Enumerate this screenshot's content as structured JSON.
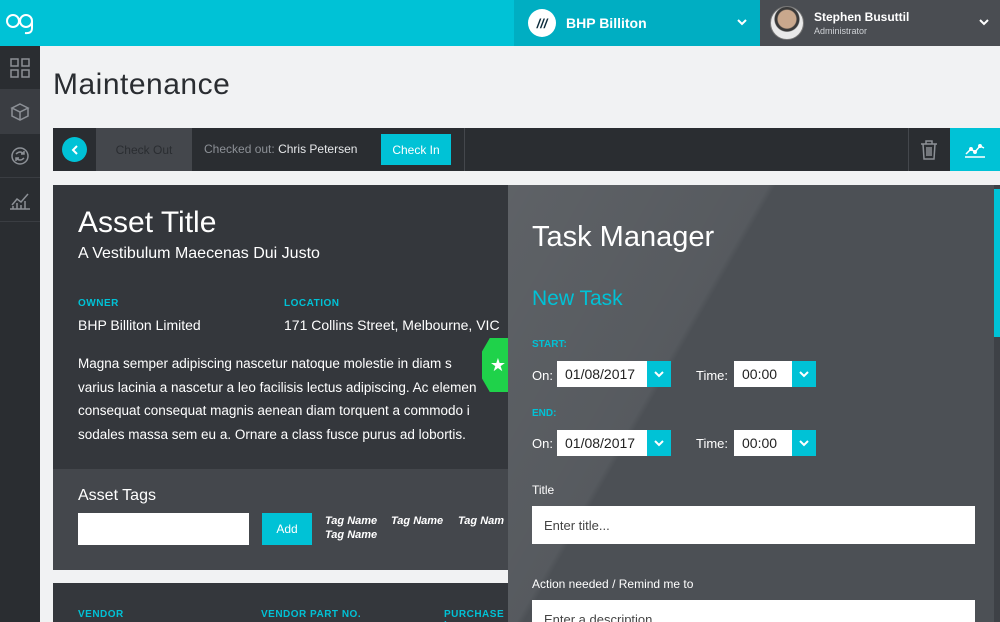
{
  "header": {
    "company": {
      "name": "BHP Billiton",
      "logo_text": "///"
    },
    "user": {
      "name": "Stephen Busuttil",
      "role": "Administrator"
    }
  },
  "sidebar": {
    "items": [
      {
        "icon": "dashboard-grid-icon"
      },
      {
        "icon": "cube-icon",
        "active": true
      },
      {
        "icon": "refresh-cycle-icon"
      },
      {
        "icon": "analytics-chart-icon"
      }
    ]
  },
  "page": {
    "title": "Maintenance"
  },
  "toolbar": {
    "checkout_label": "Check Out",
    "checked_out_prefix": "Checked out:",
    "checked_out_person": "Chris Petersen",
    "checkin_label": "Check In"
  },
  "asset": {
    "title": "Asset Title",
    "subtitle": "A Vestibulum Maecenas Dui Justo",
    "owner_label": "OWNER",
    "owner_value": "BHP Billiton Limited",
    "location_label": "LOCATION",
    "location_value": "171 Collins Street, Melbourne, VIC",
    "description_lines": [
      "Magna semper adipiscing nascetur natoque molestie in diam s",
      "varius lacinia a nascetur a leo facilisis lectus adipiscing. Ac elemen",
      "consequat consequat magnis aenean diam torquent a commodo i",
      "sodales massa sem eu a. Ornare a class fusce purus ad lobortis."
    ]
  },
  "tags": {
    "title": "Asset Tags",
    "add_label": "Add",
    "items": [
      "Tag Name",
      "Tag Name",
      "Tag Nam",
      "Tag Name"
    ]
  },
  "vendor": {
    "vendor_label": "VENDOR",
    "part_label": "VENDOR PART NO.",
    "purchase_label": "PURCHASE I"
  },
  "task_manager": {
    "title": "Task Manager",
    "new_task": "New Task",
    "start_label": "START:",
    "end_label": "END:",
    "on_label": "On:",
    "time_label": "Time:",
    "start_date": "01/08/2017",
    "start_time": "00:00",
    "end_date": "01/08/2017",
    "end_time": "00:00",
    "title_field_label": "Title",
    "title_placeholder": "Enter title...",
    "action_label": "Action needed / Remind me to",
    "description_placeholder": "Enter a description..."
  },
  "colors": {
    "accent": "#00c2d6",
    "dark": "#2a2d31",
    "panel": "#34373c",
    "flag": "#1fd24a"
  }
}
